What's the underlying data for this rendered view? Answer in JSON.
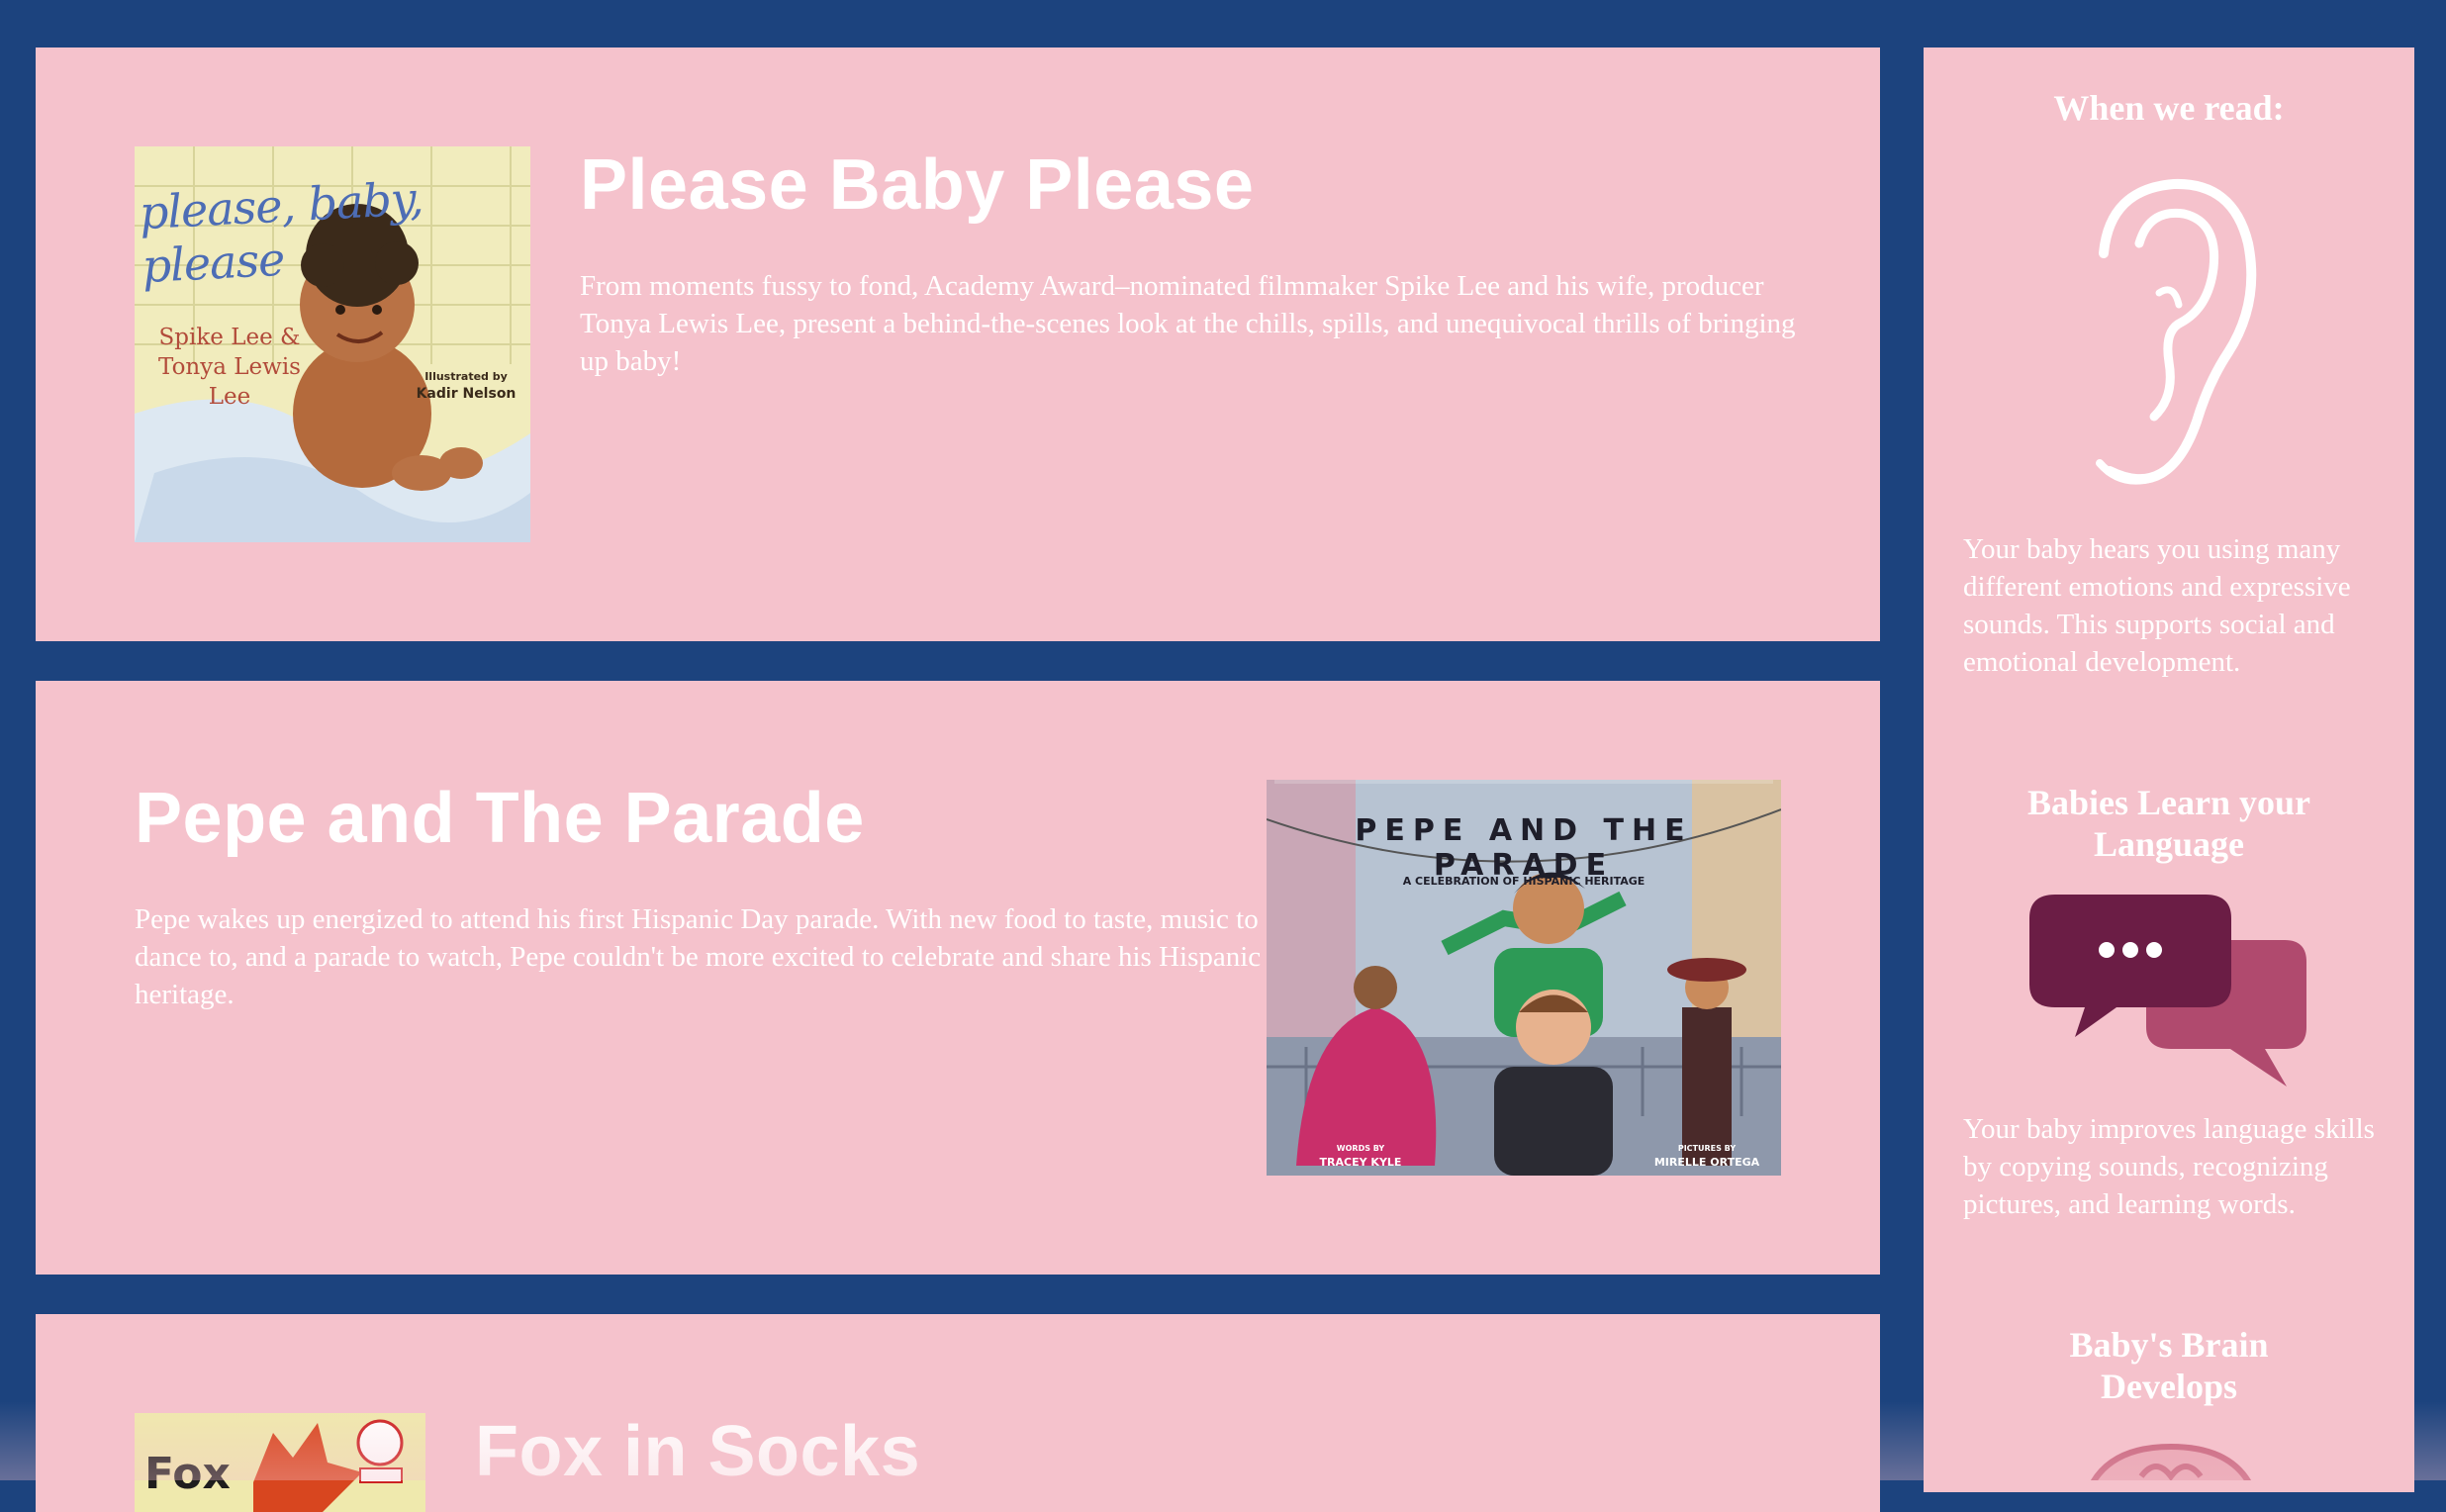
{
  "books": [
    {
      "title": "Please Baby Please",
      "description": "From moments fussy to fond, Academy Award–nominated filmmaker Spike Lee and his wife, producer Tonya Lewis Lee, present a behind-the-scenes look at the chills, spills, and unequivocal thrills of bringing up baby!",
      "cover": {
        "title": "please, baby, please",
        "authors": "Spike Lee & Tonya Lewis Lee",
        "illustrated_by": "Illustrated by",
        "illustrator": "Kadir Nelson"
      }
    },
    {
      "title": "Pepe and The Parade",
      "description": "Pepe wakes up energized to attend his first Hispanic Day parade. With new food to taste, music to dance to, and a parade to watch, Pepe couldn't be more excited to celebrate and share his Hispanic heritage.",
      "cover": {
        "banner": "PEPE AND THE PARADE",
        "subtitle": "A CELEBRATION OF HISPANIC HERITAGE",
        "words_by": "WORDS BY",
        "author": "TRACEY KYLE",
        "pictures_by": "PICTURES BY",
        "illustrator": "MIRELLE ORTEGA"
      }
    },
    {
      "title": "Fox in Socks",
      "cover": {
        "title": "Fox"
      }
    }
  ],
  "sidebar": {
    "heading": "When we read:",
    "sections": [
      {
        "icon": "ear-icon",
        "text": "Your baby hears you using many different emotions and expressive sounds. This supports social and emotional development."
      },
      {
        "heading": "Babies Learn your Language",
        "icon": "speech-bubbles-icon",
        "text": "Your baby improves language skills by copying sounds, recognizing pictures, and learning words."
      },
      {
        "heading": "Baby's Brain Develops",
        "icon": "brain-icon"
      }
    ]
  },
  "colors": {
    "page_background": "#1c437e",
    "card_background": "#f5c2cc",
    "text": "#ffffff",
    "bubble_dark": "#6b1d45",
    "bubble_light": "#b04a6e"
  }
}
